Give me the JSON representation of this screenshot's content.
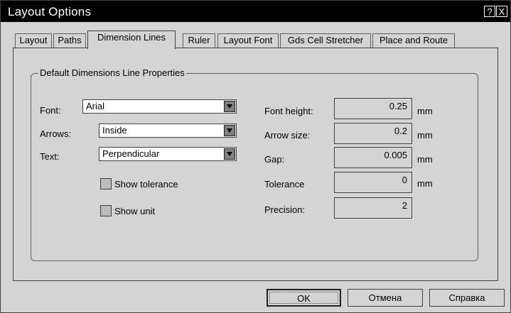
{
  "window": {
    "title": "Layout Options",
    "help_icon": "?",
    "close_icon": "X"
  },
  "tabs": [
    {
      "label": "Layout"
    },
    {
      "label": "Paths"
    },
    {
      "label": "Dimension Lines",
      "active": true
    },
    {
      "label": "Ruler"
    },
    {
      "label": "Layout Font"
    },
    {
      "label": "Gds Cell Stretcher"
    },
    {
      "label": "Place and Route"
    }
  ],
  "group": {
    "title": "Default Dimensions Line Properties"
  },
  "font": {
    "label": "Font:",
    "value": "Arial"
  },
  "arrows": {
    "label": "Arrows:",
    "value": "Inside"
  },
  "text": {
    "label": "Text:",
    "value": "Perpendicular"
  },
  "show_tolerance": {
    "label": "Show tolerance",
    "checked": false
  },
  "show_unit": {
    "label": "Show unit",
    "checked": false
  },
  "font_height": {
    "label": "Font height:",
    "value": "0.25",
    "unit": "mm"
  },
  "arrow_size": {
    "label": "Arrow size:",
    "value": "0.2",
    "unit": "mm"
  },
  "gap": {
    "label": "Gap:",
    "value": "0.005",
    "unit": "mm"
  },
  "tolerance": {
    "label": "Tolerance",
    "value": "0",
    "unit": "mm"
  },
  "precision": {
    "label": "Precision:",
    "value": "2"
  },
  "buttons": {
    "ok": "OK",
    "cancel": "Отмена",
    "help": "Справка"
  }
}
